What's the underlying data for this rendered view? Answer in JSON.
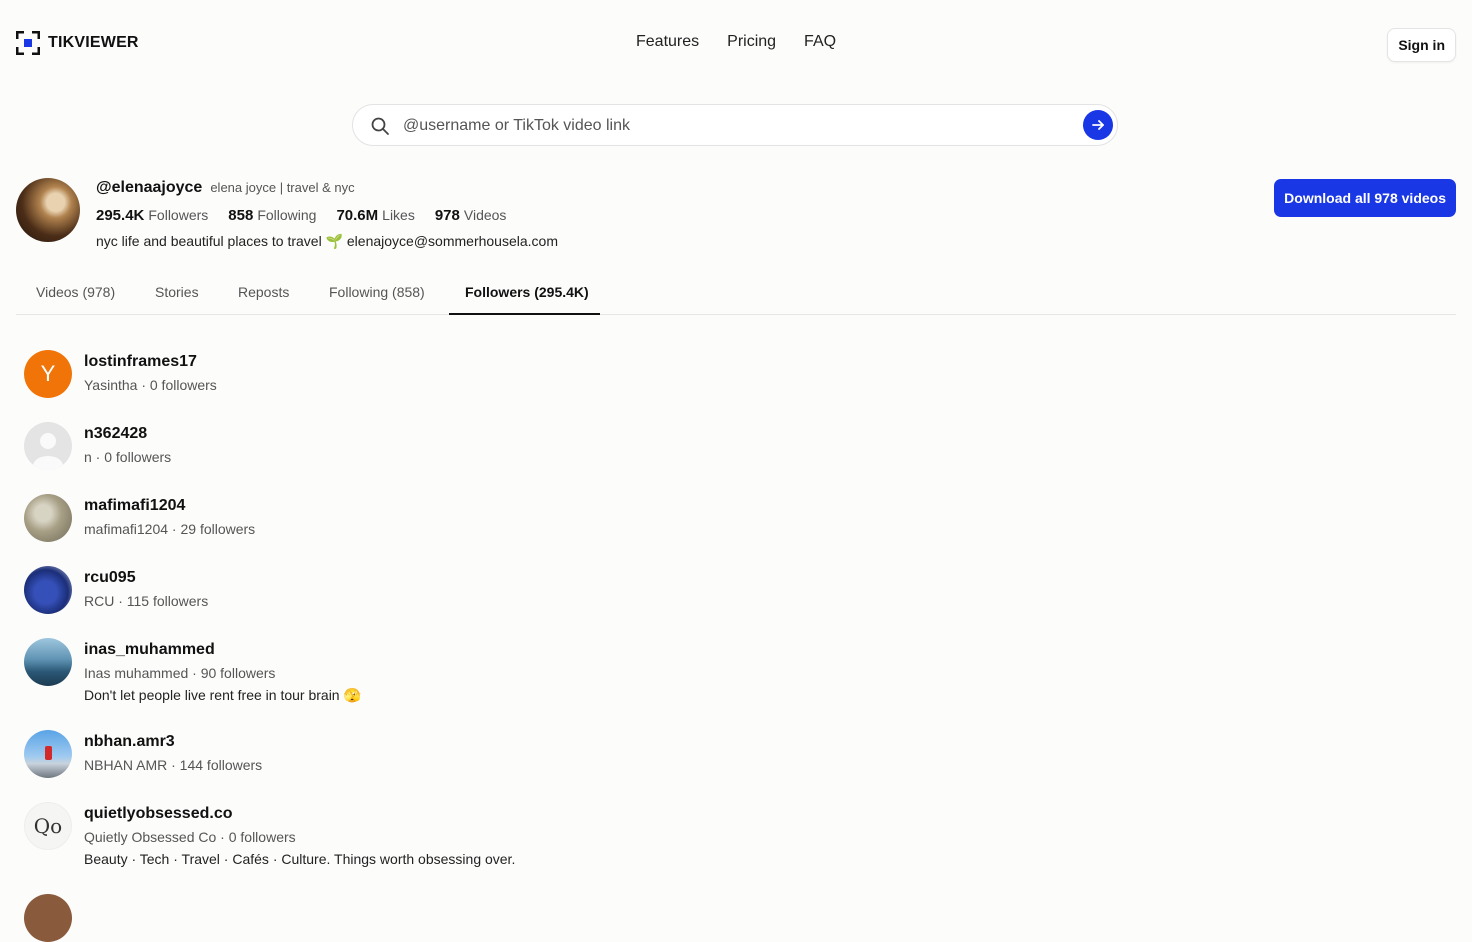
{
  "brand": {
    "name": "TIKVIEWER"
  },
  "nav": {
    "features": "Features",
    "pricing": "Pricing",
    "faq": "FAQ"
  },
  "header": {
    "signin_label": "Sign in"
  },
  "search": {
    "placeholder": "@username or TikTok video link",
    "value": ""
  },
  "profile": {
    "handle": "@elenaajoyce",
    "display_name": "elena joyce | travel & nyc",
    "followers_count": "295.4K",
    "followers_label": "Followers",
    "following_count": "858",
    "following_label": "Following",
    "likes_count": "70.6M",
    "likes_label": "Likes",
    "videos_count": "978",
    "videos_label": "Videos",
    "bio": "nyc life and beautiful places to travel 🌱 elenajoyce@sommerhousela.com",
    "download_label": "Download all 978 videos"
  },
  "tabs": [
    {
      "label": "Videos (978)"
    },
    {
      "label": "Stories"
    },
    {
      "label": "Reposts"
    },
    {
      "label": "Following (858)"
    },
    {
      "label": "Followers (295.4K)",
      "active": true
    }
  ],
  "followers": [
    {
      "username": "lostinframes17",
      "subtitle": "Yasintha · 0 followers",
      "bio": "",
      "avatar_letter": "Y"
    },
    {
      "username": "n362428",
      "subtitle": "n · 0 followers",
      "bio": ""
    },
    {
      "username": "mafimafi1204",
      "subtitle": "mafimafi1204 · 29 followers",
      "bio": ""
    },
    {
      "username": "rcu095",
      "subtitle": "RCU · 115 followers",
      "bio": ""
    },
    {
      "username": "inas_muhammed",
      "subtitle": "Inas muhammed · 90 followers",
      "bio": "Don't let people live rent free in tour brain 🫣"
    },
    {
      "username": "nbhan.amr3",
      "subtitle": "NBHAN AMR · 144 followers",
      "bio": ""
    },
    {
      "username": "quietlyobsessed.co",
      "subtitle": "Quietly Obsessed Co · 0 followers",
      "bio": "Beauty · Tech · Travel · Cafés · Culture. Things worth obsessing over.",
      "avatar_letter": "Qo"
    }
  ],
  "colors": {
    "accent": "#1a37e6",
    "orange_avatar": "#f07408",
    "background": "#fcfcfb"
  }
}
